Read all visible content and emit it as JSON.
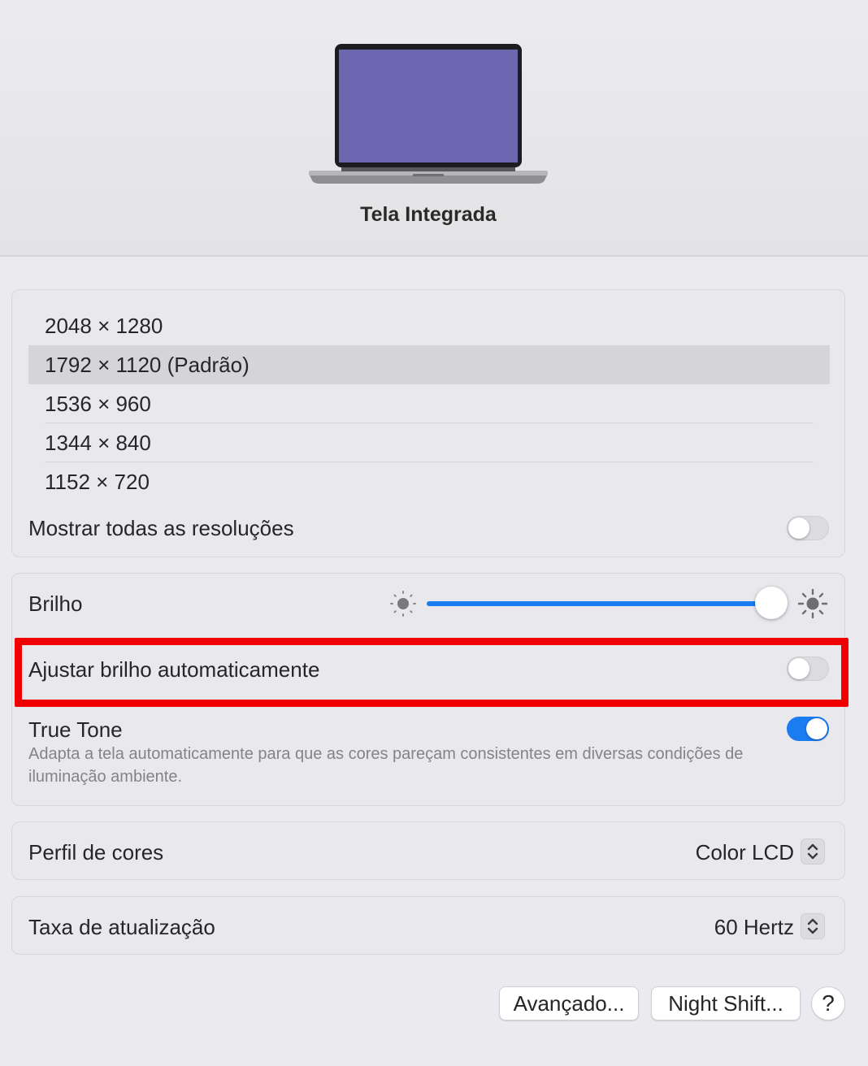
{
  "display": {
    "name": "Tela Integrada",
    "laptop_icon": "macbook-icon",
    "screen_color": "#6c67b0"
  },
  "resolutions": {
    "items": [
      {
        "label": "2048 × 1280",
        "selected": false
      },
      {
        "label": "1792 × 1120 (Padrão)",
        "selected": true
      },
      {
        "label": "1536 × 960",
        "selected": false
      },
      {
        "label": "1344 × 840",
        "selected": false
      },
      {
        "label": "1152 × 720",
        "selected": false
      }
    ],
    "show_all_label": "Mostrar todas as resoluções",
    "show_all_on": false
  },
  "brightness": {
    "label": "Brilho",
    "level_percent": 100,
    "min_icon": "sun-dim-icon",
    "max_icon": "sun-bright-icon"
  },
  "auto_brightness": {
    "label": "Ajustar brilho automaticamente",
    "on": false
  },
  "true_tone": {
    "label": "True Tone",
    "description": "Adapta a tela automaticamente para que as cores pareçam consistentes em diversas condições de iluminação ambiente.",
    "on": true
  },
  "color_profile": {
    "label": "Perfil de cores",
    "value": "Color LCD"
  },
  "refresh_rate": {
    "label": "Taxa de atualização",
    "value": "60 Hertz"
  },
  "buttons": {
    "advanced": "Avançado...",
    "night_shift": "Night Shift...",
    "help": "?"
  },
  "colors": {
    "accent": "#1b7cf2",
    "highlight": "#f00000"
  }
}
